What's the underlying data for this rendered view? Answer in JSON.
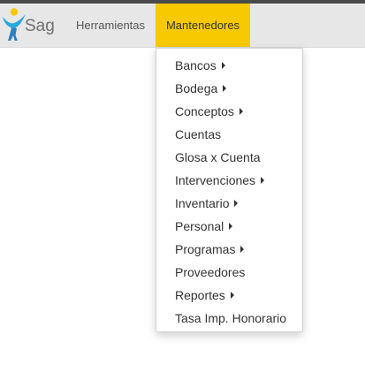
{
  "brand": {
    "name": "Sag",
    "logo_icon": "person-figure-logo-icon",
    "colors": {
      "head": "#f6c900",
      "body": "#2aa7de",
      "legs": "#2e7fc0",
      "text": "#6f6f6f"
    }
  },
  "nav": {
    "items": [
      {
        "label": "Herramientas",
        "active": false
      },
      {
        "label": "Mantenedores",
        "active": true
      }
    ],
    "active_color": "#f6c900",
    "bar_color": "#e7e7e7"
  },
  "dropdown": {
    "items": [
      {
        "label": "Bancos",
        "submenu": true
      },
      {
        "label": "Bodega",
        "submenu": true
      },
      {
        "label": "Conceptos",
        "submenu": true
      },
      {
        "label": "Cuentas",
        "submenu": false
      },
      {
        "label": "Glosa x Cuenta",
        "submenu": false
      },
      {
        "label": "Intervenciones",
        "submenu": true
      },
      {
        "label": "Inventario",
        "submenu": true
      },
      {
        "label": "Personal",
        "submenu": true
      },
      {
        "label": "Programas",
        "submenu": true
      },
      {
        "label": "Proveedores",
        "submenu": false
      },
      {
        "label": "Reportes",
        "submenu": true
      },
      {
        "label": "Tasa Imp. Honorario",
        "submenu": false
      }
    ],
    "submenu_icon": "caret-right-icon"
  }
}
